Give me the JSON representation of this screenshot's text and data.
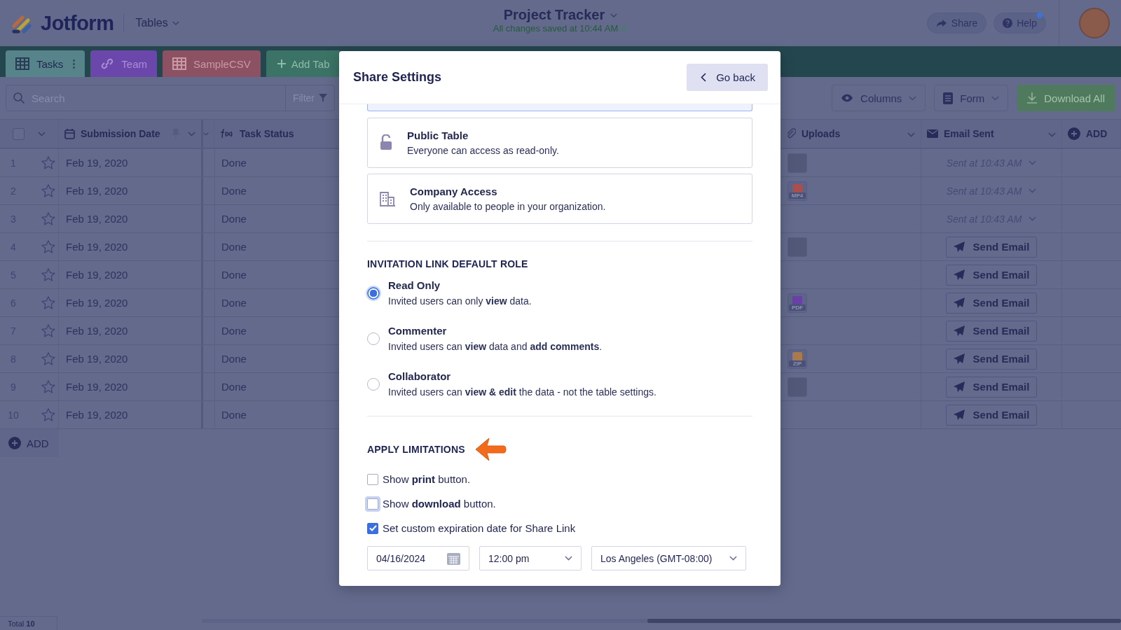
{
  "header": {
    "logo": "Jotform",
    "product": "Tables",
    "title": "Project Tracker",
    "save_status": "All changes saved at 10:44 AM",
    "share": "Share",
    "help": "Help",
    "help_notification": true
  },
  "tabs": [
    {
      "label": "Tasks",
      "kind": "grid",
      "selected": true,
      "color": "#57848a"
    },
    {
      "label": "Team",
      "kind": "link",
      "selected": false,
      "color": "#6c47ab"
    },
    {
      "label": "SampleCSV",
      "kind": "grid",
      "selected": false,
      "color": "#8c5264"
    }
  ],
  "add_tab": "Add Tab",
  "toolbar": {
    "search_placeholder": "Search",
    "filter": "Filter",
    "columns": "Columns",
    "form": "Form",
    "download_all": "Download All"
  },
  "table": {
    "select_all_checked": false,
    "columns": [
      {
        "label": "Submission Date",
        "kind": "calendar"
      },
      {
        "label": "Task Status",
        "kind": "formula"
      },
      {
        "label": "Uploads",
        "kind": "paperclip"
      },
      {
        "label": "Email Sent",
        "kind": "envelope"
      }
    ],
    "add_column": "ADD",
    "rows": [
      {
        "number": "1",
        "starred": false,
        "date": "Feb 19, 2020",
        "status": "Done",
        "upload": {
          "kind": "thumbnail"
        },
        "email": {
          "kind": "sent",
          "text": "Sent at 10:43 AM"
        }
      },
      {
        "number": "2",
        "starred": false,
        "date": "Feb 19, 2020",
        "status": "Done",
        "upload": {
          "kind": "file",
          "label": "MP4",
          "color": "#a8504e"
        },
        "email": {
          "kind": "sent",
          "text": "Sent at 10:43 AM"
        }
      },
      {
        "number": "3",
        "starred": false,
        "date": "Feb 19, 2020",
        "status": "Done",
        "email": {
          "kind": "sent",
          "text": "Sent at 10:43 AM"
        }
      },
      {
        "number": "4",
        "starred": false,
        "date": "Feb 19, 2020",
        "status": "Done",
        "upload": {
          "kind": "thumbnail"
        },
        "email": {
          "kind": "button",
          "text": "Send Email"
        }
      },
      {
        "number": "5",
        "starred": false,
        "date": "Feb 19, 2020",
        "status": "Done",
        "email": {
          "kind": "button",
          "text": "Send Email"
        }
      },
      {
        "number": "6",
        "starred": false,
        "date": "Feb 19, 2020",
        "status": "Done",
        "upload": {
          "kind": "file",
          "label": "PDF",
          "color": "#6a3fa6"
        },
        "email": {
          "kind": "button",
          "text": "Send Email"
        }
      },
      {
        "number": "7",
        "starred": false,
        "date": "Feb 19, 2020",
        "status": "Done",
        "email": {
          "kind": "button",
          "text": "Send Email"
        }
      },
      {
        "number": "8",
        "starred": false,
        "date": "Feb 19, 2020",
        "status": "Done",
        "upload": {
          "kind": "file",
          "label": "ZIP",
          "color": "#a97a4e"
        },
        "email": {
          "kind": "button",
          "text": "Send Email"
        }
      },
      {
        "number": "9",
        "starred": false,
        "date": "Feb 19, 2020",
        "status": "Done",
        "upload": {
          "kind": "thumbnail"
        },
        "email": {
          "kind": "button",
          "text": "Send Email"
        }
      },
      {
        "number": "10",
        "starred": false,
        "date": "Feb 19, 2020",
        "status": "Done",
        "email": {
          "kind": "button",
          "text": "Send Email"
        }
      }
    ],
    "add_row": "ADD",
    "total": "Total **10**"
  },
  "modal": {
    "title": "Share Settings",
    "back": "Go back",
    "access_options": [
      {
        "kind": "lock",
        "title": "Public Table",
        "description": "Everyone can access as read-only."
      },
      {
        "kind": "building",
        "title": "Company Access",
        "description": "Only available to people in your organization."
      }
    ],
    "role_heading": "INVITATION LINK DEFAULT ROLE",
    "roles": [
      {
        "title": "Read Only",
        "description": "Invited users can only **view** data.",
        "selected": true
      },
      {
        "title": "Commenter",
        "description": "Invited users can **view** data and **add comments**.",
        "selected": false
      },
      {
        "title": "Collaborator",
        "description": "Invited users can **view & edit** the data - not the table settings.",
        "selected": false
      }
    ],
    "limits_heading": "APPLY LIMITATIONS",
    "limits": [
      {
        "label": "Show **print** button.",
        "checked": false,
        "focused": false
      },
      {
        "label": "Show **download** button.",
        "checked": false,
        "focused": true
      },
      {
        "label": "Set custom expiration date for Share Link",
        "checked": true,
        "focused": false
      }
    ],
    "expiration": {
      "date": "04/16/2024",
      "time": "12:00 pm",
      "timezone": "Los Angeles (GMT-08:00)"
    }
  }
}
